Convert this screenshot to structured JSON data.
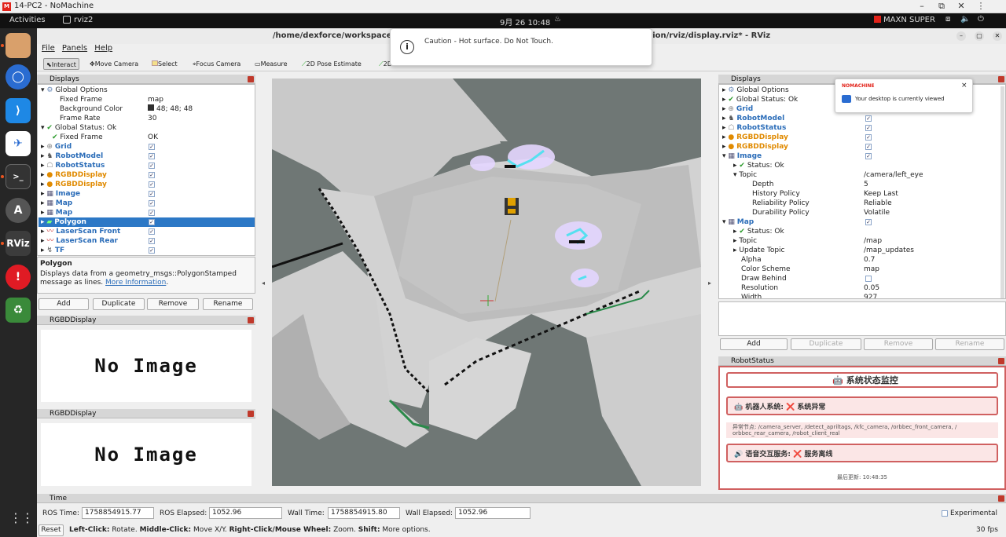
{
  "nomachine": {
    "logo": "M",
    "title": "14-PC2 - NoMachine",
    "min": "–",
    "restore": "⧉",
    "close": "✕",
    "more": "⋮",
    "notify_brand": "NOMACHINE",
    "notify_text": "Your desktop is currently viewed",
    "notify_close": "×"
  },
  "gnome": {
    "activities": "Activities",
    "app": "rviz2",
    "datetime": "9月 26  10:48",
    "power_mode": "MAXN SUPER"
  },
  "dock": {
    "rviz_label": "RViz"
  },
  "rviz": {
    "title": "/home/dexforce/workspace ... tion/rviz/display.rviz* - RViz",
    "title_left": "/home/dexforce/workspace",
    "title_right": "tion/rviz/display.rviz* - RViz",
    "menu": [
      "File",
      "Panels",
      "Help"
    ],
    "tools": [
      "Interact",
      "Move Camera",
      "Select",
      "Focus Camera",
      "Measure",
      "2D Pose Estimate",
      "2D Goal Pose",
      "Publish Point"
    ],
    "toast": "Caution - Hot surface. Do Not Touch.",
    "left_displays": {
      "header": "Displays",
      "rows": [
        {
          "n": "Global Options",
          "v": ""
        },
        {
          "n": "Fixed Frame",
          "v": "map"
        },
        {
          "n": "Background Color",
          "v": "48; 48; 48"
        },
        {
          "n": "Frame Rate",
          "v": "30"
        },
        {
          "n": "Global Status: Ok",
          "v": ""
        },
        {
          "n": "Fixed Frame",
          "v": "OK"
        },
        {
          "n": "Grid",
          "v": ""
        },
        {
          "n": "RobotModel",
          "v": ""
        },
        {
          "n": "RobotStatus",
          "v": ""
        },
        {
          "n": "RGBDDisplay",
          "v": ""
        },
        {
          "n": "RGBDDisplay",
          "v": ""
        },
        {
          "n": "Image",
          "v": ""
        },
        {
          "n": "Map",
          "v": ""
        },
        {
          "n": "Map",
          "v": ""
        },
        {
          "n": "Polygon",
          "v": ""
        },
        {
          "n": "LaserScan Front",
          "v": ""
        },
        {
          "n": "LaserScan Rear",
          "v": ""
        },
        {
          "n": "TF",
          "v": ""
        }
      ],
      "desc_title": "Polygon",
      "desc_text": "Displays data from a geometry_msgs::PolygonStamped message as lines.",
      "desc_link": "More Information",
      "desc_dot": ".",
      "buttons": [
        "Add",
        "Duplicate",
        "Remove",
        "Rename"
      ]
    },
    "rgbd1": {
      "header": "RGBDDisplay",
      "image": "No Image"
    },
    "rgbd2": {
      "header": "RGBDDisplay",
      "image": "No Image"
    },
    "right_displays": {
      "header": "Displays",
      "rows": [
        {
          "n": "Global Options",
          "v": ""
        },
        {
          "n": "Global Status: Ok",
          "v": ""
        },
        {
          "n": "Grid",
          "v": ""
        },
        {
          "n": "RobotModel",
          "v": ""
        },
        {
          "n": "RobotStatus",
          "v": ""
        },
        {
          "n": "RGBDDisplay",
          "v": ""
        },
        {
          "n": "RGBDDisplay",
          "v": ""
        },
        {
          "n": "Image",
          "v": ""
        },
        {
          "n": "Status: Ok",
          "v": ""
        },
        {
          "n": "Topic",
          "v": "/camera/left_eye"
        },
        {
          "n": "Depth",
          "v": "5"
        },
        {
          "n": "History Policy",
          "v": "Keep Last"
        },
        {
          "n": "Reliability Policy",
          "v": "Reliable"
        },
        {
          "n": "Durability Policy",
          "v": "Volatile"
        },
        {
          "n": "Map",
          "v": ""
        },
        {
          "n": "Status: Ok",
          "v": ""
        },
        {
          "n": "Topic",
          "v": "/map"
        },
        {
          "n": "Update Topic",
          "v": "/map_updates"
        },
        {
          "n": "Alpha",
          "v": "0.7"
        },
        {
          "n": "Color Scheme",
          "v": "map"
        },
        {
          "n": "Draw Behind",
          "v": ""
        },
        {
          "n": "Resolution",
          "v": "0.05"
        },
        {
          "n": "Width",
          "v": "927"
        }
      ],
      "buttons": [
        "Add",
        "Duplicate",
        "Remove",
        "Rename"
      ]
    },
    "robot_status": {
      "header": "RobotStatus",
      "title": "🤖 系统状态监控",
      "robot": "🤖 机器人系统: ❌ 系统异常",
      "nodes": "异常节点: /camera_server, /detect_apriltags, /kfc_camera, /orbbec_front_camera, / orbbec_rear_camera, /robot_client_real",
      "voice": "🔊 语音交互服务: ❌ 服务离线",
      "updated": "最后更新: 10:48:35"
    },
    "time": {
      "header": "Time",
      "ros_time_label": "ROS Time:",
      "ros_time": "1758854915.77",
      "ros_elapsed_label": "ROS Elapsed:",
      "ros_elapsed": "1052.96",
      "wall_time_label": "Wall Time:",
      "wall_time": "1758854915.80",
      "wall_elapsed_label": "Wall Elapsed:",
      "wall_elapsed": "1052.96",
      "experimental": "Experimental"
    },
    "status": {
      "reset": "Reset",
      "hint_b1": "Left-Click:",
      "hint_t1": " Rotate. ",
      "hint_b2": "Middle-Click:",
      "hint_t2": " Move X/Y. ",
      "hint_b3": "Right-Click/Mouse Wheel:",
      "hint_t3": " Zoom. ",
      "hint_b4": "Shift:",
      "hint_t4": " More options.",
      "fps": "30 fps"
    }
  }
}
